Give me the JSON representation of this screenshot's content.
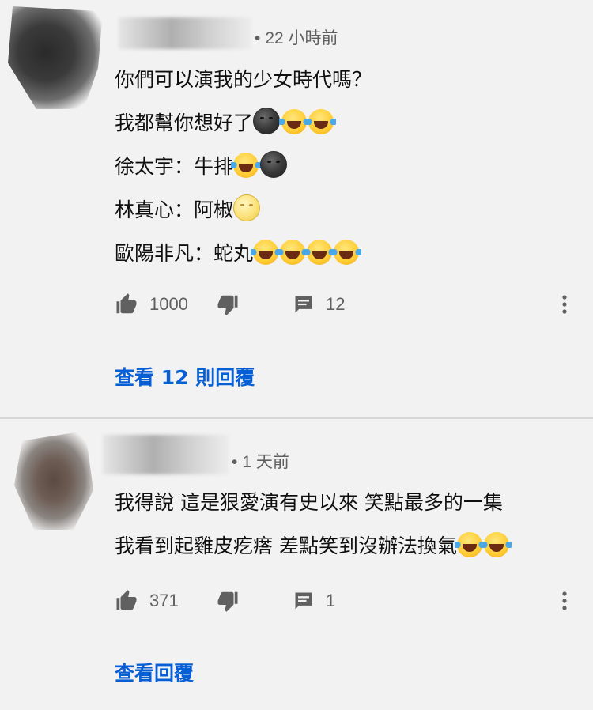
{
  "comments": [
    {
      "timestamp": "22 小時前",
      "lines": [
        {
          "text": "你們可以演我的少女時代嗎？",
          "emojis": []
        },
        {
          "text": "我都幫你想好了",
          "emojis": [
            "new-moon-face",
            "tears-of-joy",
            "tears-of-joy"
          ]
        },
        {
          "text": "徐太宇：牛排",
          "emojis": [
            "tears-of-joy",
            "new-moon-face"
          ]
        },
        {
          "text": "林真心：阿椒",
          "emojis": [
            "full-moon-face"
          ]
        },
        {
          "text": "歐陽非凡：蛇丸",
          "emojis": [
            "tears-of-joy",
            "tears-of-joy",
            "tears-of-joy",
            "tears-of-joy"
          ]
        }
      ],
      "likes": "1000",
      "replies_count": "12",
      "view_replies_label": "查看 12 則回覆"
    },
    {
      "timestamp": "1 天前",
      "lines": [
        {
          "text": "我得說 這是狠愛演有史以來 笑點最多的一集",
          "emojis": []
        },
        {
          "text": "我看到起雞皮疙瘩 差點笑到沒辦法換氣",
          "emojis": [
            "tears-of-joy",
            "tears-of-joy"
          ]
        }
      ],
      "likes": "371",
      "replies_count": "1",
      "view_replies_label": "查看回覆"
    }
  ],
  "icons": {
    "like": "thumbs-up-icon",
    "dislike": "thumbs-down-icon",
    "reply": "comment-icon",
    "more": "more-vertical-icon"
  },
  "colors": {
    "background": "#f2f2f2",
    "link": "#065fd4",
    "secondary_text": "#606060",
    "primary_text": "#0f0f0f"
  }
}
